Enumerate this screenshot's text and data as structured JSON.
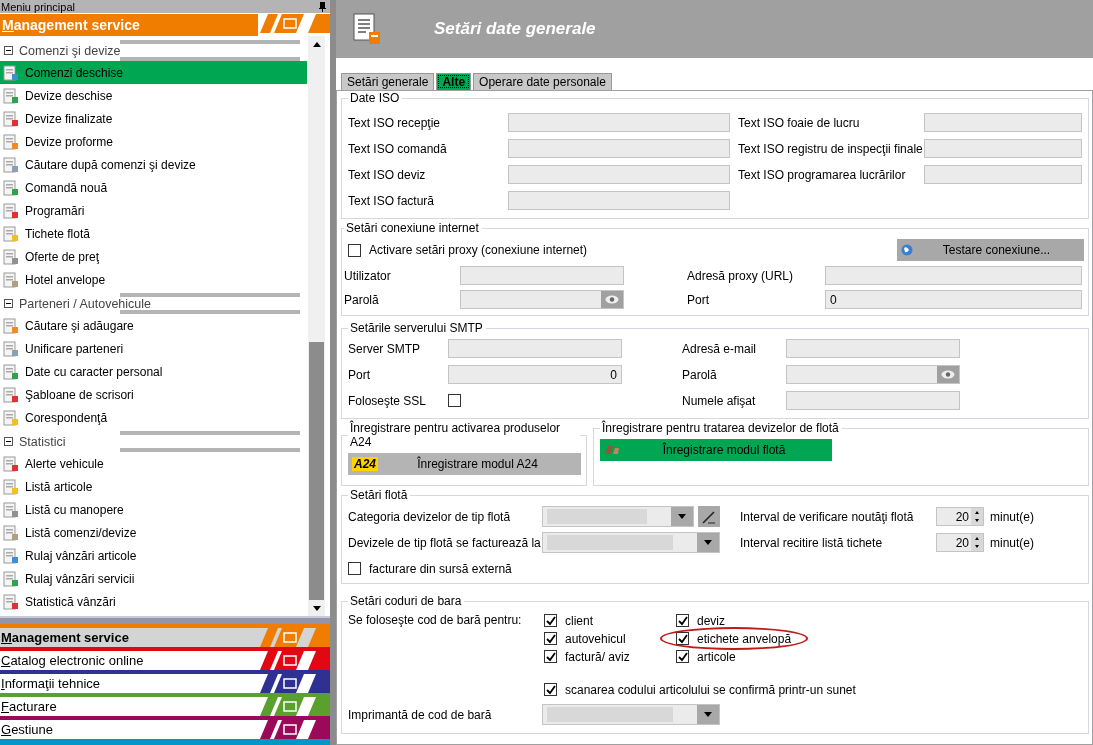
{
  "sidebar": {
    "title": "Meniu principal",
    "module": "Management service",
    "groups": [
      {
        "label": "Comenzi şi devize",
        "expanded": true,
        "items": [
          {
            "label": "Comenzi deschise",
            "selected": true
          },
          {
            "label": "Devize deschise",
            "selected": false
          },
          {
            "label": "Devize finalizate",
            "selected": false
          },
          {
            "label": "Devize proforme",
            "selected": false
          },
          {
            "label": "Căutare după comenzi şi devize",
            "selected": false
          },
          {
            "label": "Comandă nouă",
            "selected": false
          },
          {
            "label": "Programări",
            "selected": false
          },
          {
            "label": "Tichete flotă",
            "selected": false
          },
          {
            "label": "Oferte de preţ",
            "selected": false
          },
          {
            "label": "Hotel anvelope",
            "selected": false
          }
        ]
      },
      {
        "label": "Parteneri / Autovehicule",
        "expanded": true,
        "items": [
          {
            "label": "Căutare şi adăugare",
            "selected": false
          },
          {
            "label": "Unificare parteneri",
            "selected": false
          },
          {
            "label": "Date cu caracter personal",
            "selected": false
          },
          {
            "label": "Şabloane de scrisori",
            "selected": false
          },
          {
            "label": "Corespondenţă",
            "selected": false
          }
        ]
      },
      {
        "label": "Statistici",
        "expanded": true,
        "items": [
          {
            "label": "Alerte vehicule",
            "selected": false
          },
          {
            "label": "Listă articole",
            "selected": false
          },
          {
            "label": "Listă cu manopere",
            "selected": false
          },
          {
            "label": "Listă comenzi/devize",
            "selected": false
          },
          {
            "label": "Rulaj vânzări articole",
            "selected": false
          },
          {
            "label": "Rulaj vânzări servicii",
            "selected": false
          },
          {
            "label": "Statistică vânzări",
            "selected": false
          }
        ]
      }
    ],
    "modules": [
      {
        "label": "Management service",
        "selected": true,
        "color": "#f07d00"
      },
      {
        "label": "Catalog electronic online",
        "selected": false,
        "color": "#e30613"
      },
      {
        "label": "Informaţii tehnice",
        "selected": false,
        "color": "#2e3192"
      },
      {
        "label": "Facturare",
        "selected": false,
        "color": "#5aa02c"
      },
      {
        "label": "Gestiune",
        "selected": false,
        "color": "#9b0a5a"
      }
    ]
  },
  "header": {
    "title": "Setări date generale"
  },
  "tabs": [
    {
      "label": "Setări generale",
      "selected": false
    },
    {
      "label": "Alte",
      "selected": true
    },
    {
      "label": "Operare date personale",
      "selected": false
    }
  ],
  "iso": {
    "title": "Date ISO",
    "left": [
      {
        "label": "Text ISO recepţie"
      },
      {
        "label": "Text ISO comandă"
      },
      {
        "label": "Text ISO deviz"
      },
      {
        "label": "Text ISO factură"
      }
    ],
    "right": [
      {
        "label": "Text ISO foaie de lucru"
      },
      {
        "label": "Text ISO registru de inspecţii finale"
      },
      {
        "label": "Text ISO programarea lucrărilor"
      }
    ]
  },
  "internet": {
    "title": "Setări conexiune internet",
    "proxy": {
      "label": "Activare setări proxy (conexiune internet)",
      "checked": false
    },
    "test_button": "Testare conexiune...",
    "fields": [
      {
        "label": "Utilizator",
        "kind": "text"
      },
      {
        "label": "Adresă proxy (URL)",
        "kind": "text"
      },
      {
        "label": "Parolă",
        "kind": "password"
      },
      {
        "label": "Port",
        "kind": "text",
        "value": "0"
      }
    ]
  },
  "smtp": {
    "title": "Setările serverului SMTP",
    "fields": [
      {
        "label": "Server SMTP",
        "kind": "text"
      },
      {
        "label": "Adresă e-mail",
        "kind": "text"
      },
      {
        "label": "Port",
        "kind": "number",
        "value": "0"
      },
      {
        "label": "Parolă",
        "kind": "password"
      },
      {
        "label": "Foloseşte SSL",
        "kind": "checkbox",
        "checked": false
      },
      {
        "label": "Numele afişat",
        "kind": "text"
      }
    ]
  },
  "registrations": [
    {
      "title": "Înregistrare pentru activarea produselor A24",
      "kind": "a24",
      "badge": "A24",
      "button": "Înregistrare modul A24"
    },
    {
      "title": "Înregistrare pentru tratarea devizelor de flotă",
      "kind": "fleet",
      "button": "Înregistrare modul flotă"
    }
  ],
  "fleet": {
    "title": "Setări flotă",
    "rows": [
      {
        "label": "Categoria devizelor de tip flotă",
        "kind": "select_edit"
      },
      {
        "label": "Interval de verificare noutăţi flotă",
        "kind": "spinner",
        "value": "20",
        "unit": "minut(e)"
      },
      {
        "label": "Devizele de tip flotă se facturează la",
        "kind": "select"
      },
      {
        "label": "Interval recitire listă tichete",
        "kind": "spinner",
        "value": "20",
        "unit": "minut(e)"
      }
    ],
    "external": {
      "label": "facturare din sursă externă",
      "checked": false
    }
  },
  "barcode": {
    "title": "Setări coduri de bara",
    "label": "Se foloseşte cod de bară pentru:",
    "options": [
      {
        "label": "client",
        "checked": true,
        "circled": false
      },
      {
        "label": "deviz",
        "checked": true,
        "circled": false
      },
      {
        "label": "autovehicul",
        "checked": true,
        "circled": false
      },
      {
        "label": "etichete anvelopă",
        "checked": true,
        "circled": true
      },
      {
        "label": "factură/ aviz",
        "checked": true,
        "circled": false
      },
      {
        "label": "articole",
        "checked": true,
        "circled": false
      }
    ],
    "sound": {
      "label": "scanarea codului articolului se confirmă printr-un sunet",
      "checked": true
    },
    "printer": {
      "label": "Imprimantă de cod de bară"
    }
  }
}
